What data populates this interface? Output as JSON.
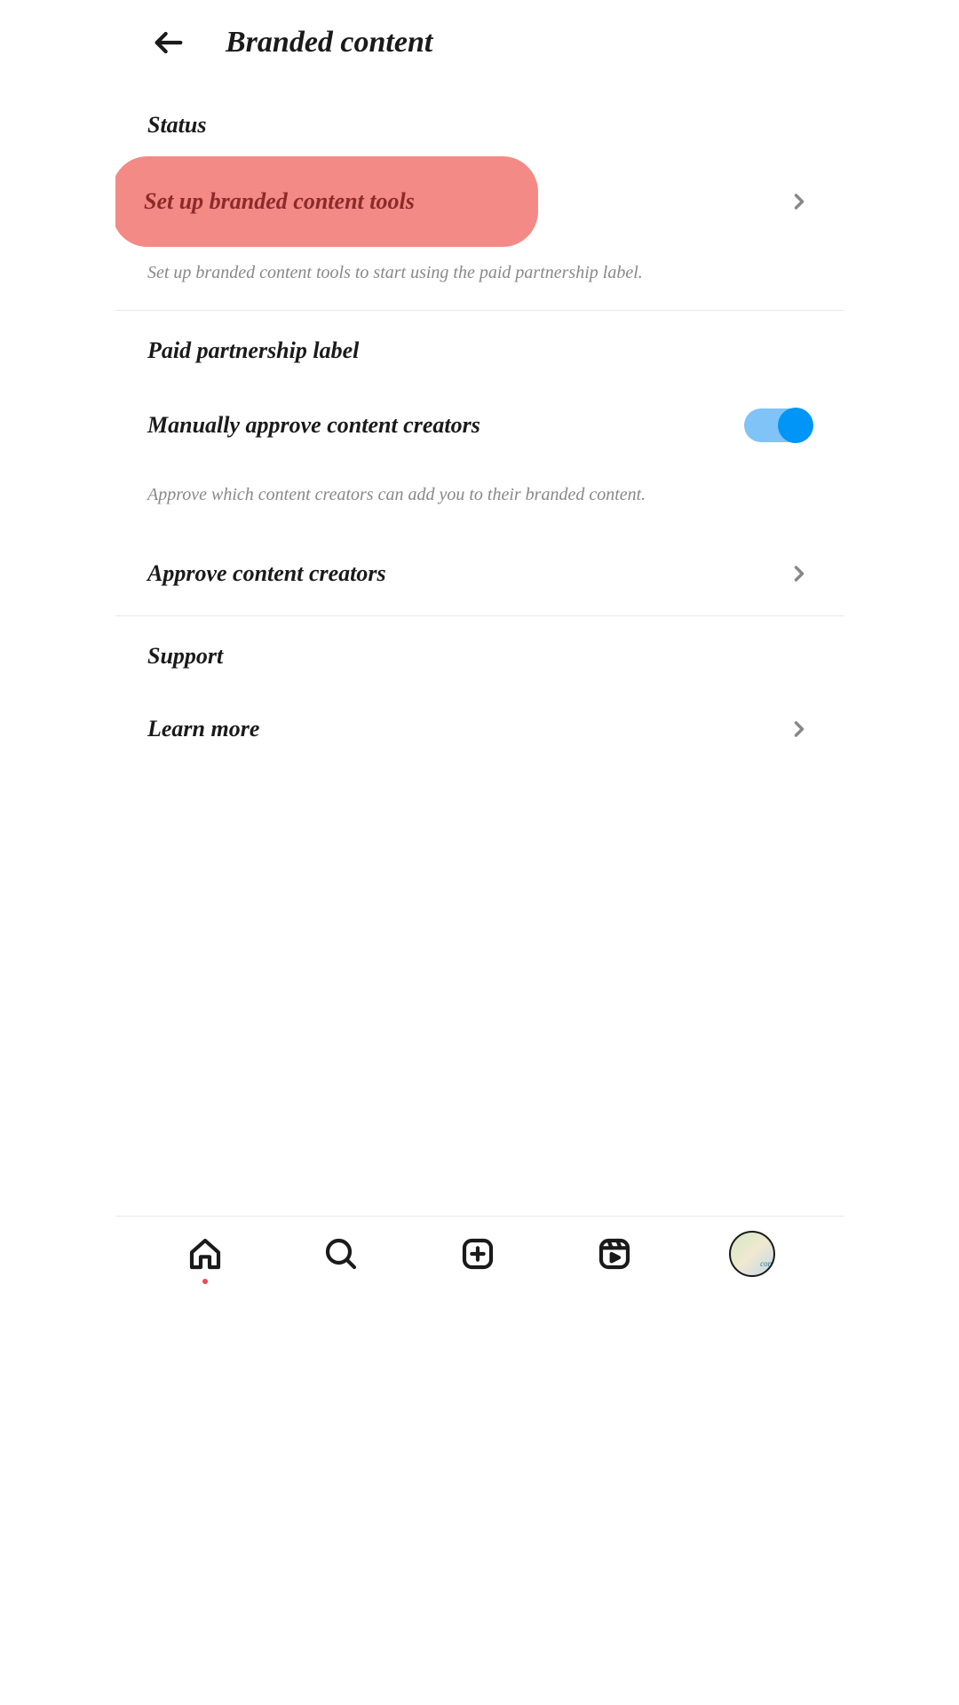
{
  "header": {
    "title": "Branded content"
  },
  "sections": {
    "status": {
      "header": "Status",
      "setup_label": "Set up branded content tools",
      "description": "Set up branded content tools to start using the paid partnership label."
    },
    "paid_partnership": {
      "header": "Paid partnership label",
      "manual_approve_label": "Manually approve content creators",
      "manual_approve_toggle": true,
      "description": "Approve which content creators can add you to their branded content.",
      "approve_creators_label": "Approve content creators"
    },
    "support": {
      "header": "Support",
      "learn_more_label": "Learn more"
    }
  }
}
